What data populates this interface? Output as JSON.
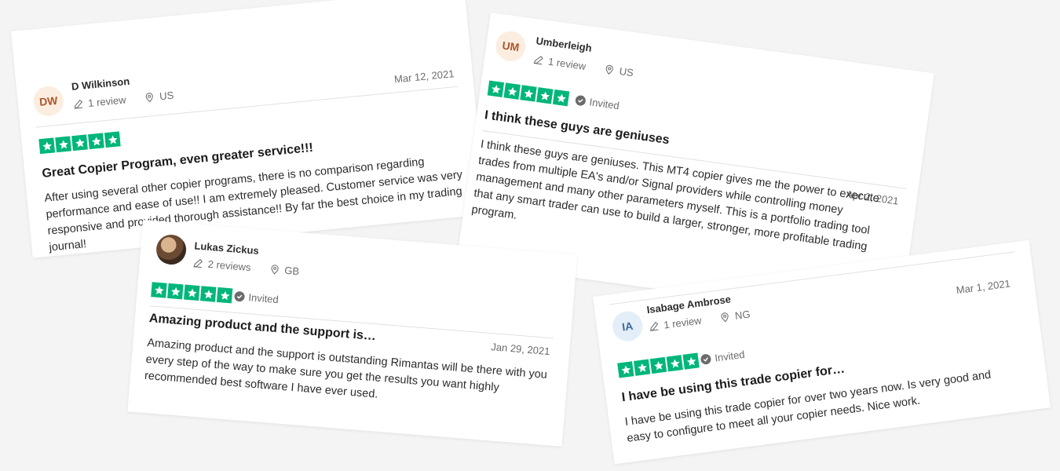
{
  "colors": {
    "star_green": "#00b67a",
    "background": "#f4f4f5"
  },
  "reviews": [
    {
      "initials": "DW",
      "name": "D Wilkinson",
      "review_count": "1 review",
      "country": "US",
      "date": "Mar 12, 2021",
      "rating": 5,
      "title": "Great Copier Program, even greater service!!!",
      "body": "After using several other copier programs, there is no comparison regarding performance and ease of use!! I am extremely pleased. Customer service was very responsive and provided thorough assistance!! By far the best choice in my trading journal!"
    },
    {
      "initials": "UM",
      "name": "Umberleigh",
      "review_count": "1 review",
      "country": "US",
      "date": "Apr 2, 2021",
      "rating": 5,
      "invited": "Invited",
      "title": "I think these guys are geniuses",
      "body": "I think these guys are geniuses. This MT4 copier gives me the power to execute trades from multiple EA's and/or Signal providers while controlling money management and many other parameters myself. This is a portfolio trading tool that any smart trader can use to build a larger, stronger, more profitable trading program."
    },
    {
      "initials": "",
      "name": "Lukas Zickus",
      "review_count": "2 reviews",
      "country": "GB",
      "date": "Jan 29, 2021",
      "rating": 5,
      "invited": "Invited",
      "title": "Amazing product and the support is…",
      "body": "Amazing product and the support is outstanding Rimantas will be there with you every step of the way to make sure you get the results you want highly recommended best software I have ever used."
    },
    {
      "initials": "IA",
      "name": "Isabage Ambrose",
      "review_count": "1 review",
      "country": "NG",
      "date": "Mar 1, 2021",
      "rating": 5,
      "invited": "Invited",
      "title": "I have be using this trade copier for…",
      "body": "I have be using this trade copier for over two years now. Is very good and easy to configure to meet all your copier needs. Nice work."
    }
  ]
}
